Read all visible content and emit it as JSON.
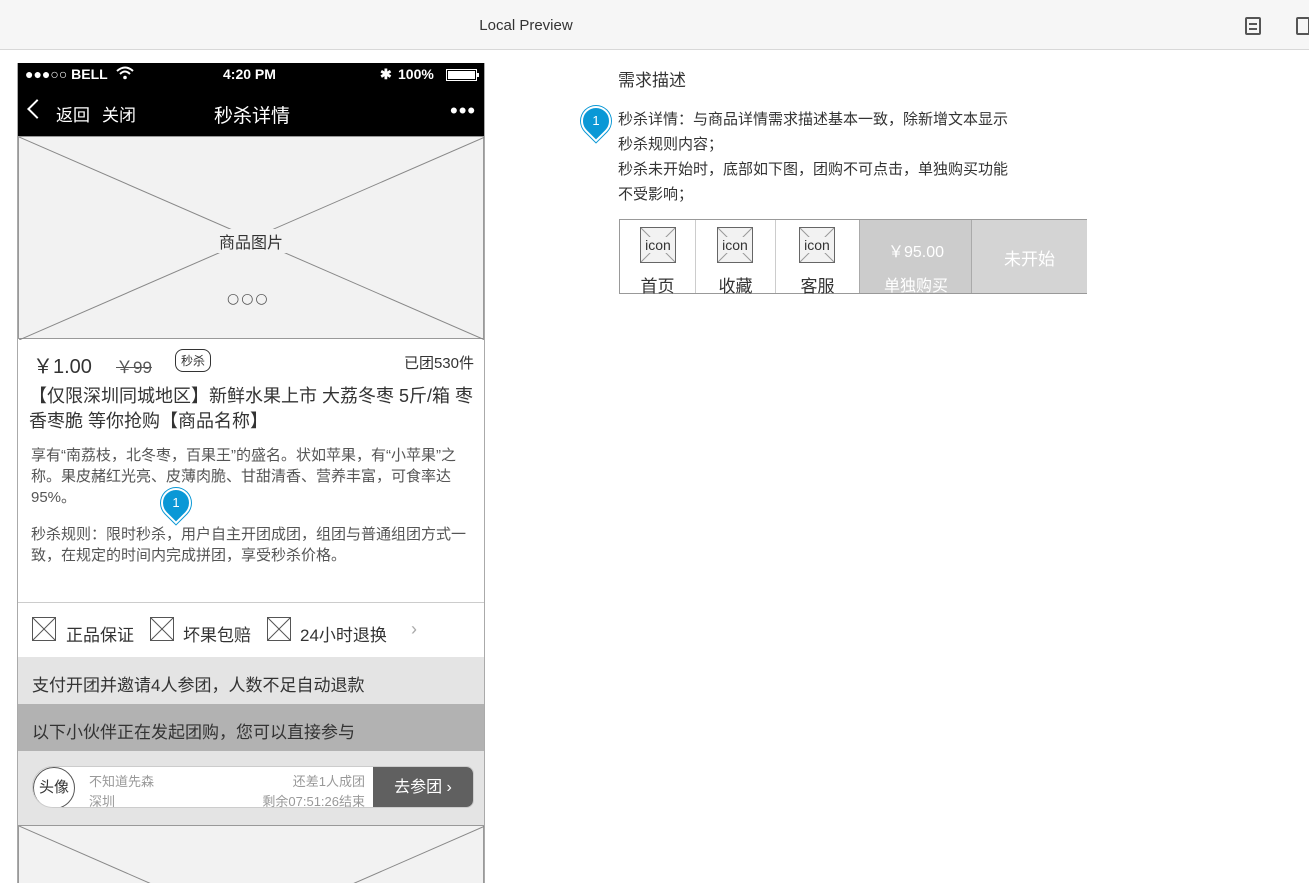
{
  "window": {
    "title": "Local Preview"
  },
  "status_bar": {
    "carrier": "●●●○○ BELL",
    "time": "4:20 PM",
    "battery": "100%"
  },
  "nav": {
    "back": "返回",
    "close": "关闭",
    "title": "秒杀详情",
    "more": "•••"
  },
  "product": {
    "image_label": "商品图片",
    "dots": "○○○",
    "price": "￥1.00",
    "original_price": "￥99",
    "badge": "秒杀",
    "sold": "已团530件",
    "name": "【仅限深圳同城地区】新鲜水果上市 大荔冬枣  5斤/箱 枣香枣脆 等你抢购【商品名称】",
    "description": "享有“南荔枝，北冬枣，百果王”的盛名。状如苹果，有“小苹果”之称。果皮赭红光亮、皮薄肉脆、甘甜清香、营养丰富，可食率达95%。",
    "rule": "秒杀规则：限时秒杀，用户自主开团成团，组团与普通组团方式一致，在规定的时间内完成拼团，享受秒杀价格。"
  },
  "guarantees": [
    "正品保证",
    "坏果包赔",
    "24小时退换"
  ],
  "banners": {
    "open_group": "支付开团并邀请4人参团，人数不足自动退款",
    "join_list": "以下小伙伴正在发起团购，您可以直接参与"
  },
  "group": {
    "avatar": "头像",
    "name": "不知道先森",
    "city": "深圳",
    "need": "还差1人成团",
    "remaining": "剩余07:51:26结束",
    "join_button": "去参团 ›"
  },
  "marker": {
    "number": "1"
  },
  "requirement": {
    "title": "需求描述",
    "lines": [
      "秒杀详情：与商品详情需求描述基本一致，除新增文本显示",
      "秒杀规则内容；",
      "秒杀未开始时，底部如下图，团购不可点击，单独购买功能",
      "不受影响；"
    ]
  },
  "tabbar": {
    "icon_text": "icon",
    "home": "首页",
    "favorite": "收藏",
    "service": "客服",
    "buy_price": "￥95.00",
    "buy_label": "单独购买",
    "not_started": "未开始"
  },
  "colors": {
    "marker": "#0a98d6",
    "join_button": "#606060",
    "banner_dark": "#b2b2b2",
    "banner_light": "#e4e4e4"
  }
}
